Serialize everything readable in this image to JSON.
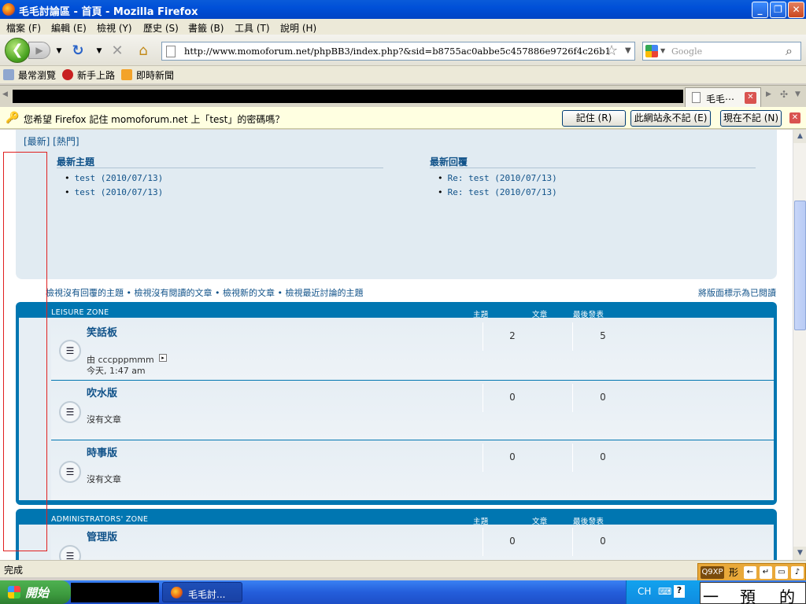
{
  "window": {
    "title": "毛毛討論區 - 首頁 - Mozilla Firefox"
  },
  "menu": [
    "檔案 (F)",
    "編輯 (E)",
    "檢視 (Y)",
    "歷史 (S)",
    "書籤 (B)",
    "工具 (T)",
    "說明 (H)"
  ],
  "address": {
    "url": "http://www.momoforum.net/phpBB3/index.php?&sid=b8755ac0abbe5c457886e9726f4c26b1"
  },
  "search": {
    "placeholder": "Google"
  },
  "bookmarks": [
    "最常瀏覽",
    "新手上路",
    "即時新聞"
  ],
  "tab": {
    "label": "毛毛⋯"
  },
  "password_prompt": {
    "message": "您希望 Firefox 記住 momoforum.net 上「test」的密碼嗎？",
    "remember": "記住 (R)",
    "never": "此網站永不記 (E)",
    "not_now": "現在不記 (N)"
  },
  "recent": {
    "tabs": "[最新]  [熱門]",
    "new_topics": {
      "title": "最新主題",
      "items": [
        "test (2010/07/13)",
        "test (2010/07/13)"
      ]
    },
    "new_replies": {
      "title": "最新回覆",
      "items": [
        "Re: test (2010/07/13)",
        "Re: test (2010/07/13)"
      ]
    }
  },
  "quick_links": "檢視沒有回覆的主題 • 檢視沒有閱讀的文章 • 檢視新的文章 • 檢視最近討論的主題",
  "mark_read": "將版面標示為已閱讀",
  "categories": [
    {
      "name": "LEISURE ZONE",
      "cols": {
        "topics": "主題",
        "posts": "文章",
        "last_post": "最後發表"
      },
      "forums": [
        {
          "name": "笑話板",
          "topics": "2",
          "posts": "5",
          "last_by": "由 cccpppmmm",
          "last_time": "今天, 1:47 am"
        },
        {
          "name": "吹水版",
          "topics": "0",
          "posts": "0",
          "last_by": "沒有文章",
          "last_time": ""
        },
        {
          "name": "時事版",
          "topics": "0",
          "posts": "0",
          "last_by": "沒有文章",
          "last_time": ""
        }
      ]
    },
    {
      "name": "ADMINISTRATORS' ZONE",
      "cols": {
        "topics": "主題",
        "posts": "文章",
        "last_post": "最後發表"
      },
      "forums": [
        {
          "name": "管理版",
          "topics": "0",
          "posts": "0"
        }
      ]
    }
  ],
  "status": "完成",
  "taskbar": {
    "start": "開始",
    "task": "毛毛討...",
    "lang": "CH"
  },
  "ime": {
    "mode": "Q9XP",
    "shape": "形",
    "candidates": [
      "一",
      "預",
      "的"
    ]
  },
  "colors": {
    "forum_blue": "#0076b1",
    "link": "#105289",
    "panel": "#e1ebf2"
  }
}
